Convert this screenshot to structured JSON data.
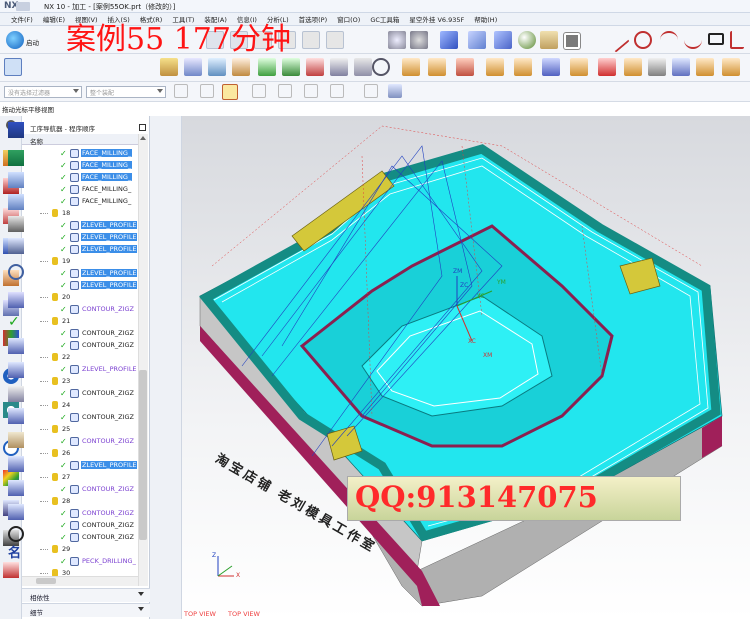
{
  "window": {
    "logo": "NX",
    "title": "NX 10 - 加工 - [案例55OK.prt（修改的）]"
  },
  "menu": [
    "文件(F)",
    "编辑(E)",
    "视图(V)",
    "插入(S)",
    "格式(R)",
    "工具(T)",
    "装配(A)",
    "信息(I)",
    "分析(L)",
    "首选项(P)",
    "窗口(O)",
    "GC工具箱",
    "星空外挂 V6.935F",
    "帮助(H)"
  ],
  "overlay_title": "案例55   177分钟",
  "toolbar": {
    "start_label": "启动",
    "filter_combo": "没有选择过滤器",
    "assembly_combo": "整个装配"
  },
  "hint": "拖动光标平移视图",
  "navigator": {
    "title": "工序导航器 - 程序顺序",
    "column": "名称",
    "rows": [
      {
        "type": "op",
        "name": "FACE_MILLING_",
        "style": "sel"
      },
      {
        "type": "op",
        "name": "FACE_MILLING_",
        "style": "sel"
      },
      {
        "type": "op",
        "name": "FACE_MILLING_",
        "style": "sel"
      },
      {
        "type": "op",
        "name": "FACE_MILLING_",
        "style": "plain"
      },
      {
        "type": "op",
        "name": "FACE_MILLING_",
        "style": "plain"
      },
      {
        "type": "group",
        "name": "18"
      },
      {
        "type": "op",
        "name": "ZLEVEL_PROFILE",
        "style": "sel"
      },
      {
        "type": "op",
        "name": "ZLEVEL_PROFILE",
        "style": "sel"
      },
      {
        "type": "op",
        "name": "ZLEVEL_PROFILE",
        "style": "sel"
      },
      {
        "type": "group",
        "name": "19"
      },
      {
        "type": "op",
        "name": "ZLEVEL_PROFILE",
        "style": "sel"
      },
      {
        "type": "op",
        "name": "ZLEVEL_PROFILE",
        "style": "sel"
      },
      {
        "type": "group",
        "name": "20"
      },
      {
        "type": "op",
        "name": "CONTOUR_ZIGZ",
        "style": "purple"
      },
      {
        "type": "group",
        "name": "21"
      },
      {
        "type": "op",
        "name": "CONTOUR_ZIGZ",
        "style": "plain"
      },
      {
        "type": "op",
        "name": "CONTOUR_ZIGZ",
        "style": "plain"
      },
      {
        "type": "group",
        "name": "22"
      },
      {
        "type": "op",
        "name": "ZLEVEL_PROFILE",
        "style": "purple"
      },
      {
        "type": "group",
        "name": "23"
      },
      {
        "type": "op",
        "name": "CONTOUR_ZIGZ",
        "style": "plain"
      },
      {
        "type": "group",
        "name": "24"
      },
      {
        "type": "op",
        "name": "CONTOUR_ZIGZ",
        "style": "plain"
      },
      {
        "type": "group",
        "name": "25"
      },
      {
        "type": "op",
        "name": "CONTOUR_ZIGZ",
        "style": "purple"
      },
      {
        "type": "group",
        "name": "26"
      },
      {
        "type": "op",
        "name": "ZLEVEL_PROFILE",
        "style": "sel"
      },
      {
        "type": "group",
        "name": "27"
      },
      {
        "type": "op",
        "name": "CONTOUR_ZIGZ",
        "style": "purple"
      },
      {
        "type": "group",
        "name": "28"
      },
      {
        "type": "op",
        "name": "CONTOUR_ZIGZ",
        "style": "purple"
      },
      {
        "type": "op",
        "name": "CONTOUR_ZIGZ",
        "style": "plain"
      },
      {
        "type": "op",
        "name": "CONTOUR_ZIGZ",
        "style": "plain"
      },
      {
        "type": "group",
        "name": "29"
      },
      {
        "type": "op",
        "name": "PECK_DRILLING_",
        "style": "purple"
      },
      {
        "type": "group",
        "name": "30"
      }
    ],
    "footer": [
      "相依性",
      "细节"
    ]
  },
  "viewport": {
    "part_text": "淘宝店铺  老刘模具工作室",
    "axis_labels": [
      "ZM",
      "ZC",
      "YM",
      "YC",
      "XC",
      "XM",
      "Z",
      "X"
    ],
    "view_labels": [
      "TOP VIEW",
      "TOP VIEW"
    ]
  },
  "watermark": "QQ:913147075",
  "colors": {
    "cyan": "#1ee6ee",
    "teal": "#14a090",
    "purple": "#a0205a",
    "yellow": "#d4c83a",
    "select": "#3b8ee8",
    "title_red": "#ff1414"
  }
}
